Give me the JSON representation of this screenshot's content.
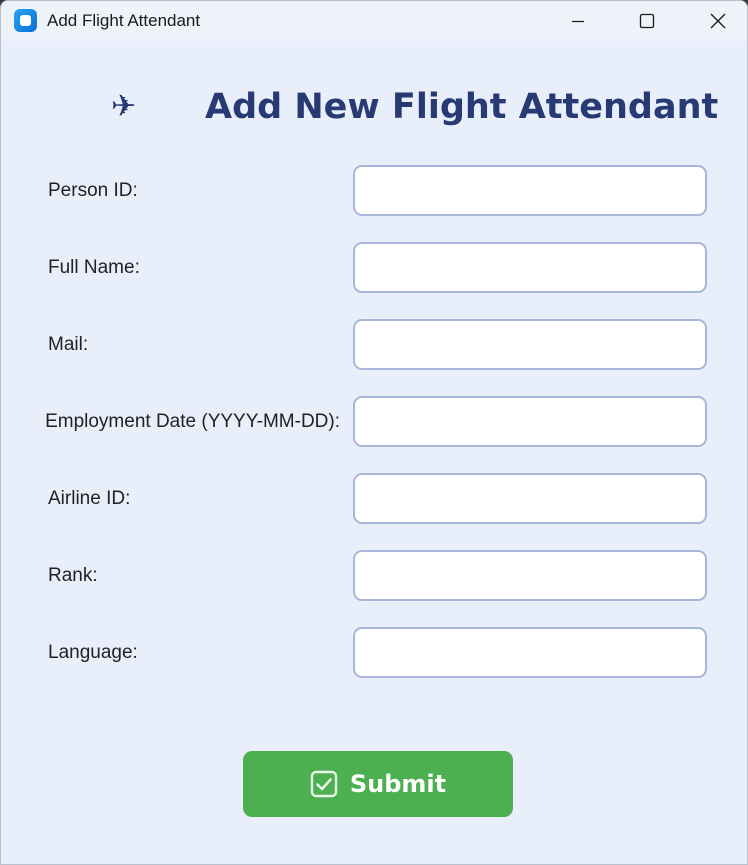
{
  "window": {
    "title": "Add Flight Attendant",
    "controls": {
      "minimize": "minimize-icon",
      "maximize": "maximize-icon",
      "close": "close-icon"
    }
  },
  "header": {
    "icon": "✈",
    "title": "Add New Flight Attendant"
  },
  "form": {
    "fields": [
      {
        "label": "Person ID:",
        "value": ""
      },
      {
        "label": "Full Name:",
        "value": ""
      },
      {
        "label": "Mail:",
        "value": ""
      },
      {
        "label": "Employment Date (YYYY-MM-DD):",
        "value": ""
      },
      {
        "label": "Airline ID:",
        "value": ""
      },
      {
        "label": "Rank:",
        "value": ""
      },
      {
        "label": "Language:",
        "value": ""
      }
    ]
  },
  "submit": {
    "icon": "checkbox-checked-icon",
    "label": "Submit"
  },
  "colors": {
    "background": "#e9eefb",
    "heading": "#273a73",
    "submit": "#4caf50",
    "input_border": "#a9b6d9"
  }
}
